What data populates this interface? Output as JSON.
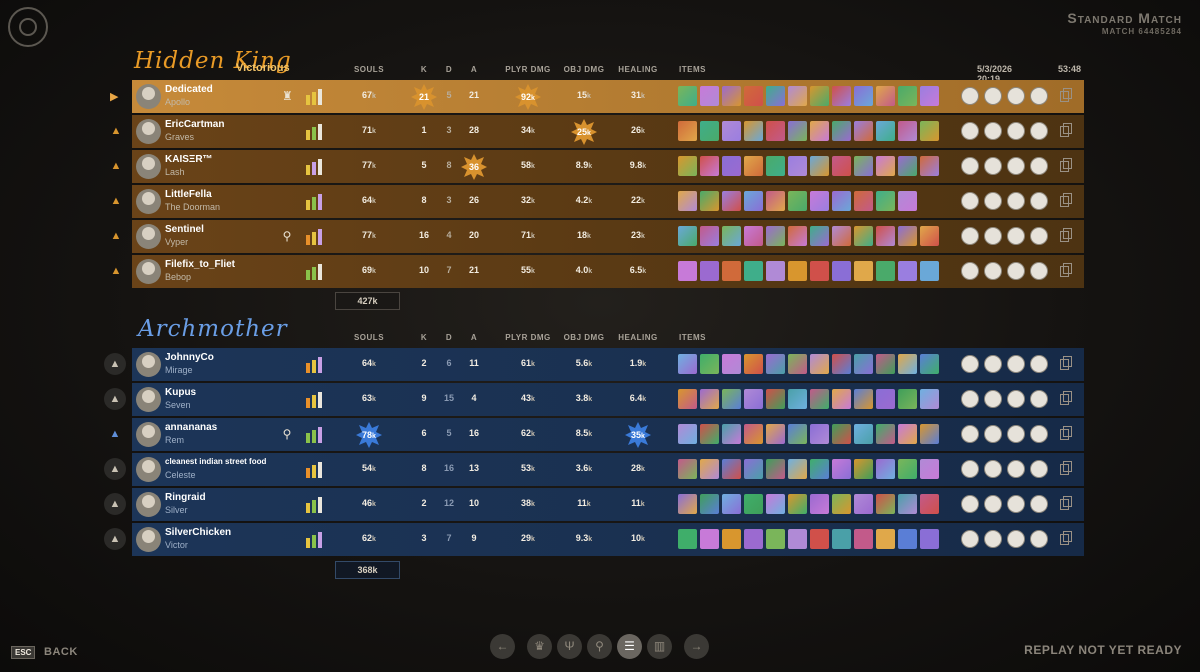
{
  "header": {
    "match_type": "Standard Match",
    "match_id": "MATCH 64485284"
  },
  "columns": {
    "souls": "SOULS",
    "k": "K",
    "d": "D",
    "a": "A",
    "player_damage": "PLYR DMG",
    "objective_damage": "OBJ DMG",
    "healing": "HEALING",
    "items": "ITEMS"
  },
  "team_a": {
    "name": "Hidden King",
    "result": "Victorious",
    "date": "5/3/2026 20:19",
    "duration": "53:48",
    "total_souls": "427k",
    "players": [
      {
        "name": "Dedicated",
        "hero": "Apollo",
        "souls": "67",
        "k": "21",
        "d": "5",
        "a": "21",
        "pdmg": "92",
        "odmg": "15",
        "heal": "31",
        "role_icon": "beacon-icon",
        "bars": "yyw",
        "badges": [
          "k",
          "pdmg"
        ]
      },
      {
        "name": "EricCartman",
        "hero": "Graves",
        "souls": "71",
        "k": "1",
        "d": "3",
        "a": "28",
        "pdmg": "34",
        "odmg": "25",
        "heal": "26",
        "role_icon": "",
        "bars": "ygw",
        "badges": [
          "odmg"
        ]
      },
      {
        "name": "KAISΞR™",
        "hero": "Lash",
        "souls": "77",
        "k": "5",
        "d": "8",
        "a": "36",
        "pdmg": "58",
        "odmg": "8.9",
        "heal": "9.8",
        "role_icon": "",
        "bars": "ypw",
        "badges": [
          "a"
        ]
      },
      {
        "name": "LittleFella",
        "hero": "The Doorman",
        "souls": "64",
        "k": "8",
        "d": "3",
        "a": "26",
        "pdmg": "32",
        "odmg": "4.2",
        "heal": "22",
        "role_icon": "",
        "bars": "ygp",
        "badges": []
      },
      {
        "name": "Sentinel",
        "hero": "Vyper",
        "souls": "77",
        "k": "16",
        "d": "4",
        "a": "20",
        "pdmg": "71",
        "odmg": "18",
        "heal": "23",
        "role_icon": "keyhole-icon",
        "bars": "oyp",
        "badges": []
      },
      {
        "name": "Filefix_to_Fliet",
        "hero": "Bebop",
        "souls": "69",
        "k": "10",
        "d": "7",
        "a": "21",
        "pdmg": "55",
        "odmg": "4.0",
        "heal": "6.5",
        "role_icon": "",
        "bars": "ggw",
        "badges": []
      }
    ]
  },
  "team_b": {
    "name": "Archmother",
    "total_souls": "368k",
    "players": [
      {
        "name": "JohnnyCo",
        "hero": "Mirage",
        "souls": "64",
        "k": "2",
        "d": "6",
        "a": "11",
        "pdmg": "61",
        "odmg": "5.6",
        "heal": "1.9",
        "role_icon": "",
        "bars": "oyp",
        "badges": []
      },
      {
        "name": "Kupus",
        "hero": "Seven",
        "souls": "63",
        "k": "9",
        "d": "15",
        "a": "4",
        "pdmg": "43",
        "odmg": "3.8",
        "heal": "6.4",
        "role_icon": "",
        "bars": "oyw",
        "badges": []
      },
      {
        "name": "annananas",
        "hero": "Rem",
        "souls": "78",
        "k": "6",
        "d": "5",
        "a": "16",
        "pdmg": "62",
        "odmg": "8.5",
        "heal": "35",
        "role_icon": "keyhole-icon",
        "bars": "ggp",
        "badges": [
          "souls",
          "heal"
        ]
      },
      {
        "name": "cleanest indian street food",
        "hero": "Celeste",
        "souls": "54",
        "k": "8",
        "d": "16",
        "a": "13",
        "pdmg": "53",
        "odmg": "3.6",
        "heal": "28",
        "role_icon": "",
        "bars": "oyw",
        "badges": []
      },
      {
        "name": "Ringraid",
        "hero": "Silver",
        "souls": "46",
        "k": "2",
        "d": "12",
        "a": "10",
        "pdmg": "38",
        "odmg": "11",
        "heal": "11",
        "role_icon": "",
        "bars": "ygw",
        "badges": []
      },
      {
        "name": "SilverChicken",
        "hero": "Victor",
        "souls": "62",
        "k": "3",
        "d": "7",
        "a": "9",
        "pdmg": "29",
        "odmg": "9.3",
        "heal": "10",
        "role_icon": "",
        "bars": "ygp",
        "badges": []
      }
    ]
  },
  "units": {
    "thousands": "k"
  },
  "footer": {
    "esc_key": "ESC",
    "back_label": "BACK",
    "replay_status": "REPLAY NOT YET READY"
  },
  "nav_icons": [
    "arrow-left-icon",
    "trophy-icon",
    "trident-icon",
    "keyhole-icon",
    "scoreboard-list-icon",
    "chart-icon",
    "arrow-right-icon"
  ],
  "nav_glyphs": [
    "←",
    "♛",
    "Ψ",
    "⚲",
    "☰",
    "▥",
    "→"
  ],
  "colors": {
    "gold_accent": "#e89a26",
    "blue_accent": "#6a9ee6",
    "badge_gold": "#d8922e",
    "badge_blue": "#3a7ad8"
  }
}
